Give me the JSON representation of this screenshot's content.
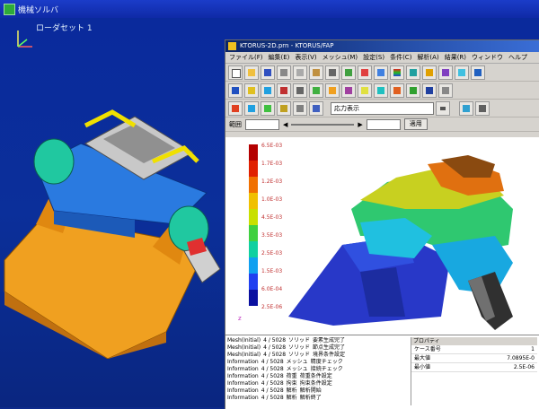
{
  "outer_window": {
    "title": "機械ソルバ"
  },
  "cad": {
    "label": "ローダセット 1"
  },
  "window": {
    "title": "KTORUS-2D.prn - KTORUS/FAP",
    "menu": [
      "ファイル(F)",
      "編集(E)",
      "表示(V)",
      "メッシュ(M)",
      "設定(S)",
      "条件(C)",
      "解析(A)",
      "結果(R)",
      "ウィンドウ",
      "ヘルプ"
    ],
    "select_value": "応力表示",
    "row4": {
      "label": "範囲",
      "apply_button": "適用",
      "arrow_left": "◀",
      "arrow_right": "▶"
    }
  },
  "colorbar": {
    "ticks": [
      "6.5E-03",
      "1.7E-03",
      "1.2E-03",
      "1.0E-03",
      "4.5E-03",
      "3.5E-03",
      "2.5E-03",
      "1.5E-03",
      "6.0E-04",
      "2.5E-06"
    ],
    "colors": [
      "#b40000",
      "#e02000",
      "#f07000",
      "#f0c000",
      "#c8e000",
      "#40d040",
      "#10d0a0",
      "#10a0f0",
      "#2040f0",
      "#0a10a0"
    ]
  },
  "log": {
    "rows": [
      [
        "Mesh(Initial)",
        "4 / 5028",
        "ソリッド",
        "要素生成完了"
      ],
      [
        "Mesh(Initial)",
        "4 / 5028",
        "ソリッド",
        "節点生成完了"
      ],
      [
        "Mesh(Initial)",
        "4 / 5028",
        "ソリッド",
        "境界条件設定"
      ],
      [
        "Information",
        "4 / 5028",
        "メッシュ",
        "精度チェック"
      ],
      [
        "Information",
        "4 / 5028",
        "メッシュ",
        "接続チェック"
      ],
      [
        "Information",
        "4 / 5028",
        "荷重",
        "荷重条件設定"
      ],
      [
        "Information",
        "4 / 5028",
        "拘束",
        "拘束条件設定"
      ],
      [
        "Information",
        "4 / 5028",
        "解析",
        "解析開始"
      ],
      [
        "Information",
        "4 / 5028",
        "解析",
        "解析終了"
      ]
    ]
  },
  "props": {
    "header": "プロパティ",
    "rows": [
      [
        "ケース番号",
        "1"
      ],
      [
        "最大値",
        "7.0895E-0"
      ],
      [
        "最小値",
        "2.5E-06"
      ]
    ]
  }
}
